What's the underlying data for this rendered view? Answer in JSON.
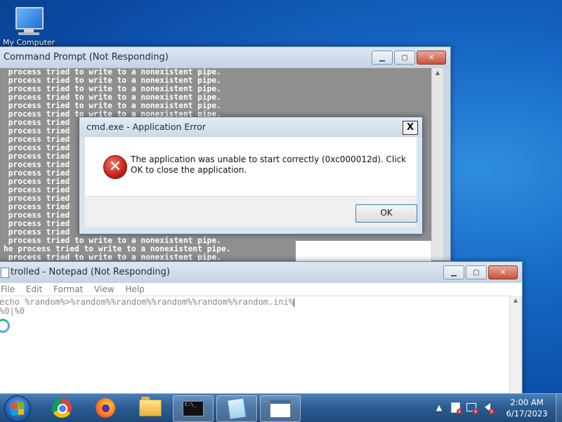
{
  "desktop": {
    "icon_label": "My Computer"
  },
  "cmd_window": {
    "title": "Command Prompt (Not Responding)",
    "lines": [
      " process tried to write to a nonexistent pipe.",
      " process tried to write to a nonexistent pipe.",
      " process tried to write to a nonexistent pipe.",
      " process tried to write to a nonexistent pipe.",
      " process tried to write to a nonexistent pipe.",
      " process tried to write to a nonexistent pipe.",
      " process tried",
      " process tried",
      " process tried",
      " process tried",
      " process tried",
      " process tried",
      " process tried",
      " process tried",
      " process tried",
      " process tried",
      " process tried",
      " process tried",
      " process tried",
      " process tried",
      " process tried to write to a nonexistent pipe.",
      "he process tried to write to a nonexistent pipe.",
      " process tried to write to a nonexistent pipe."
    ]
  },
  "error_dialog": {
    "title": "cmd.exe - Application Error",
    "close_label": "X",
    "icon_glyph": "✕",
    "message": "The application was unable to start correctly (0xc000012d). Click OK to close the application.",
    "ok_label": "OK"
  },
  "notepad": {
    "title": "trolled - Notepad (Not Responding)",
    "menu": [
      "File",
      "Edit",
      "Format",
      "View",
      "Help"
    ],
    "content_lines": [
      "echo %random%>%random%%random%%random%%random%%random.ini%",
      "%0|%0"
    ]
  },
  "caption_buttons": {
    "minimize": "▁",
    "maximize": "▢",
    "close": "✕"
  },
  "taskbar": {
    "apps": [
      "chrome",
      "firefox",
      "explorer",
      "cmd",
      "notepad",
      "window"
    ],
    "active_apps": [
      "cmd",
      "notepad",
      "window"
    ],
    "cmd_icon_text": "C:\\_",
    "clock_time": "2:00 AM",
    "clock_date": "6/17/2023",
    "tray_chevron": "▲"
  }
}
